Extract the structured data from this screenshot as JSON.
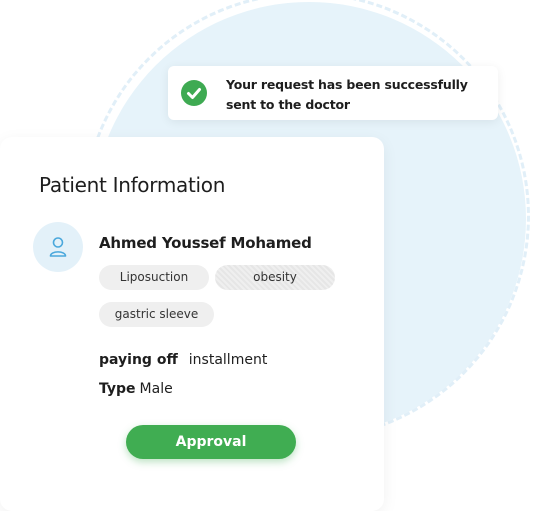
{
  "toast": {
    "icon": "check-circle-icon",
    "message": "Your request has been successfully sent to the doctor",
    "color": "#3eaa52"
  },
  "card": {
    "title": "Patient Information",
    "avatar_icon": "user-icon",
    "patient_name": "Ahmed Youssef Mohamed",
    "tags": [
      "Liposuction",
      "obesity",
      "gastric sleeve"
    ],
    "paying_off": {
      "label": "paying off",
      "value": "installment"
    },
    "type": {
      "label": "Type",
      "value": "Male"
    },
    "approval_button": "Approval"
  },
  "colors": {
    "accent_green": "#40ad52",
    "circle_bg": "#e6f3fa",
    "avatar_bg": "#e3f1f9",
    "avatar_icon": "#4aa8dc"
  }
}
